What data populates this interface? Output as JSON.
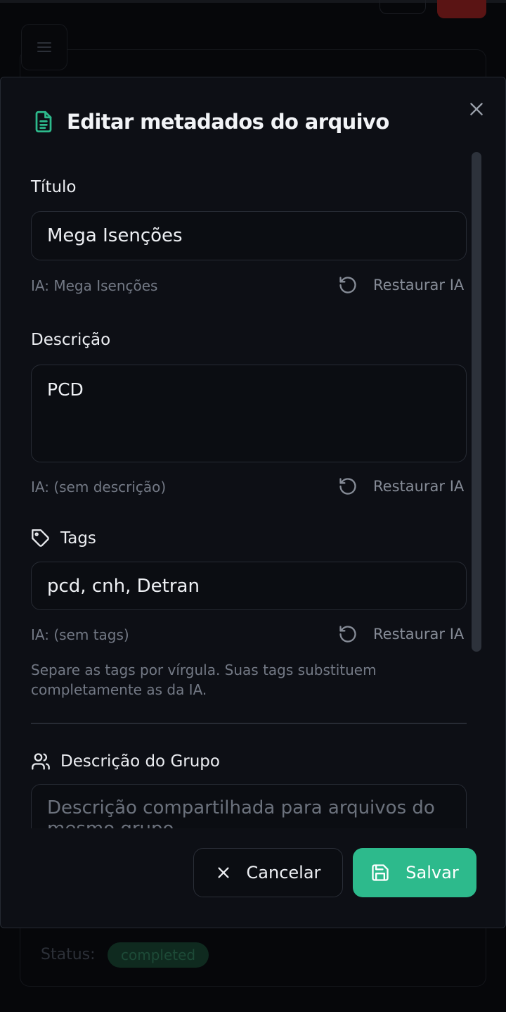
{
  "background": {
    "status_label": "Status:",
    "status_badge": "completed"
  },
  "modal": {
    "title": "Editar metadados do arquivo",
    "title_icon": "file-text-icon",
    "accent_color": "#2dba8c",
    "fields": {
      "title": {
        "label": "Título",
        "value": "Mega Isenções",
        "ia_hint": "IA: Mega Isenções",
        "restore_label": "Restaurar IA"
      },
      "description": {
        "label": "Descrição",
        "value": "PCD",
        "ia_hint": "IA: (sem descrição)",
        "restore_label": "Restaurar IA"
      },
      "tags": {
        "label": "Tags",
        "icon": "tag-icon",
        "value": "pcd, cnh, Detran",
        "ia_hint": "IA: (sem tags)",
        "restore_label": "Restaurar IA",
        "help_text": "Separe as tags por vírgula. Suas tags substituem completamente as da IA."
      },
      "group_description": {
        "label": "Descrição do Grupo",
        "icon": "users-icon",
        "placeholder": "Descrição compartilhada para arquivos do mesmo grupo..."
      }
    },
    "actions": {
      "cancel_label": "Cancelar",
      "save_label": "Salvar"
    }
  }
}
